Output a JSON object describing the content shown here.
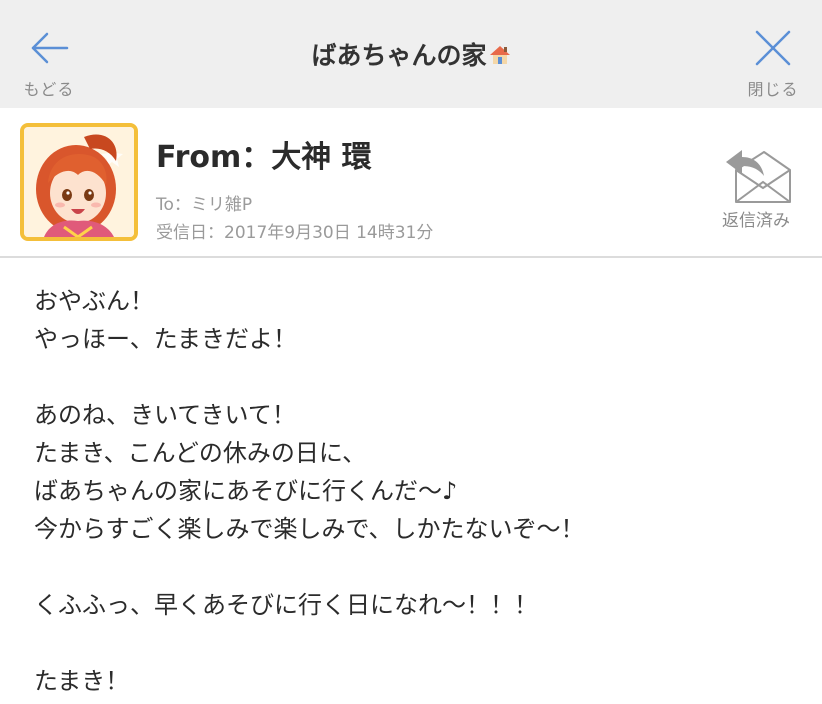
{
  "header": {
    "back_label": "もどる",
    "title": "ばあちゃんの家",
    "title_emoji": "house-icon",
    "close_label": "閉じる"
  },
  "sender": {
    "from": "From：大神 環",
    "to": "To：ミリ雑P",
    "received": "受信日：2017年9月30日 14時31分",
    "status_label": "返信済み"
  },
  "message": {
    "lines": [
      "おやぶん！",
      "やっほー、たまきだよ！",
      "",
      "あのね、きいてきいて！",
      "たまき、こんどの休みの日に、",
      "ばあちゃんの家にあそびに行くんだ～♪",
      "今からすごく楽しみで楽しみで、しかたないぞ～！",
      "",
      "くふふっ、早くあそびに行く日になれ～！！！",
      "",
      "たまき！"
    ]
  },
  "colors": {
    "header_bg": "#efefef",
    "icon_blue": "#5b8fd6",
    "avatar_border": "#f4bf3a",
    "meta_gray": "#9a9a9a"
  }
}
